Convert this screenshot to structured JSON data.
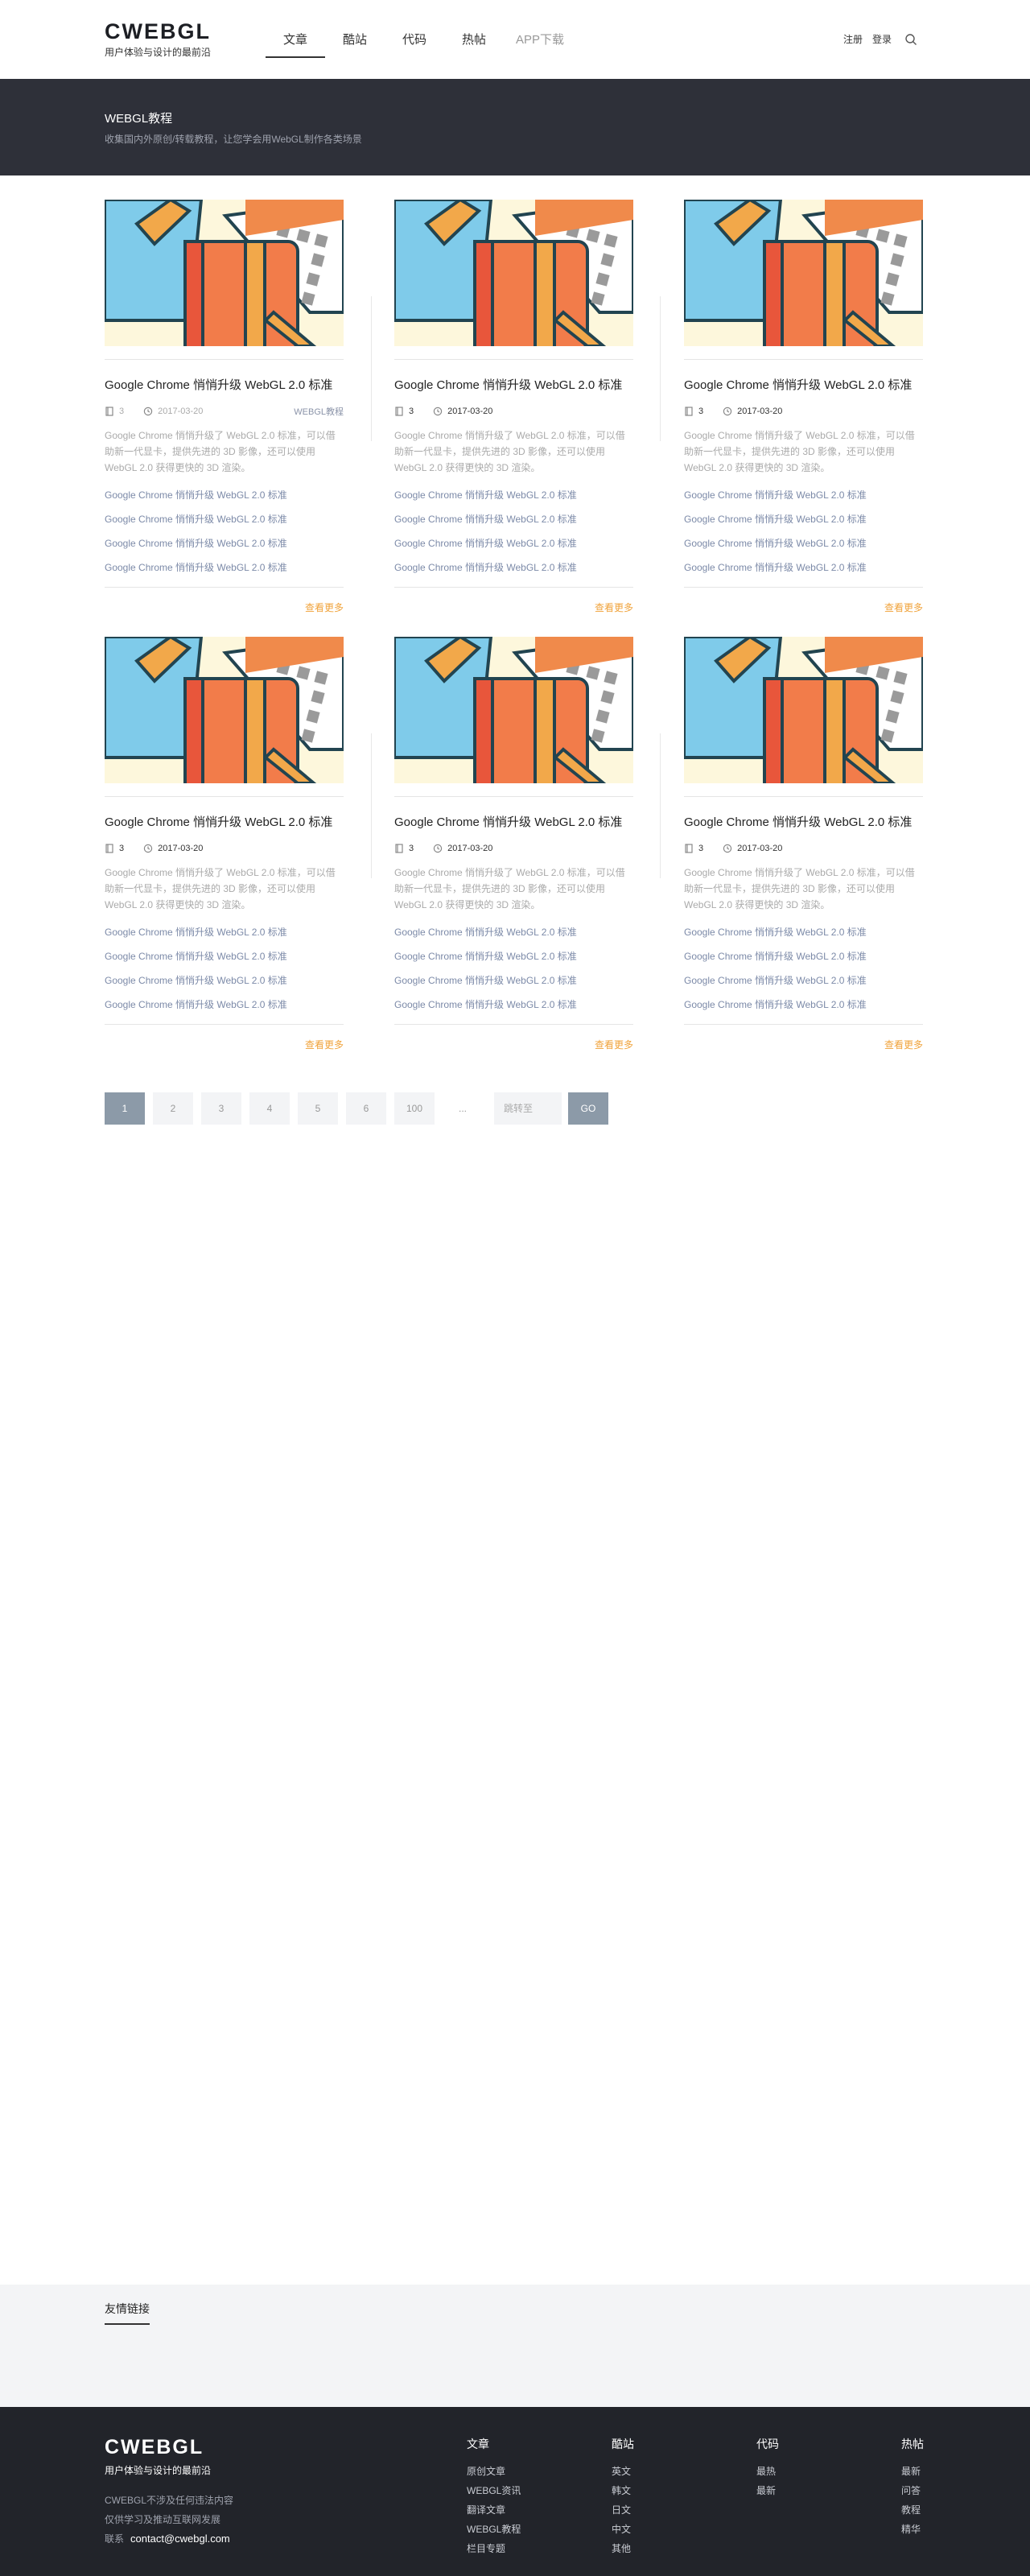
{
  "header": {
    "logo_title": "CWEBGL",
    "logo_sub": "用户体验与设计的最前沿",
    "nav": [
      "文章",
      "酷站",
      "代码",
      "热帖",
      "APP下载"
    ],
    "register": "注册",
    "login": "登录"
  },
  "banner": {
    "title": "WEBGL教程",
    "desc": "收集国内外原创/转载教程，让您学会用WebGL制作各类场景"
  },
  "cards": [
    {
      "title": "Google Chrome 悄悄升级 WebGL 2.0 标准",
      "count": "3",
      "date": "2017-03-20",
      "tag": "WEBGL教程",
      "desc": "Google Chrome 悄悄升级了 WebGL 2.0 标准，可以借助新一代显卡，提供先进的 3D 影像，还可以使用 WebGL 2.0 获得更快的 3D 渲染。",
      "links": [
        "Google Chrome 悄悄升级 WebGL 2.0 标准",
        "Google Chrome 悄悄升级 WebGL 2.0 标准",
        "Google Chrome 悄悄升级 WebGL 2.0 标准",
        "Google Chrome 悄悄升级 WebGL 2.0 标准"
      ],
      "more": "查看更多"
    },
    {
      "title": "Google Chrome 悄悄升级 WebGL 2.0 标准",
      "count": "3",
      "date": "2017-03-20",
      "tag": "",
      "desc": "Google Chrome 悄悄升级了 WebGL 2.0 标准，可以借助新一代显卡，提供先进的 3D 影像，还可以使用 WebGL 2.0 获得更快的 3D 渲染。",
      "links": [
        "Google Chrome 悄悄升级 WebGL 2.0 标准",
        "Google Chrome 悄悄升级 WebGL 2.0 标准",
        "Google Chrome 悄悄升级 WebGL 2.0 标准",
        "Google Chrome 悄悄升级 WebGL 2.0 标准"
      ],
      "more": "查看更多"
    },
    {
      "title": "Google Chrome 悄悄升级 WebGL 2.0 标准",
      "count": "3",
      "date": "2017-03-20",
      "tag": "",
      "desc": "Google Chrome 悄悄升级了 WebGL 2.0 标准，可以借助新一代显卡，提供先进的 3D 影像，还可以使用 WebGL 2.0 获得更快的 3D 渲染。",
      "links": [
        "Google Chrome 悄悄升级 WebGL 2.0 标准",
        "Google Chrome 悄悄升级 WebGL 2.0 标准",
        "Google Chrome 悄悄升级 WebGL 2.0 标准",
        "Google Chrome 悄悄升级 WebGL 2.0 标准"
      ],
      "more": "查看更多"
    },
    {
      "title": "Google Chrome 悄悄升级 WebGL 2.0 标准",
      "count": "3",
      "date": "2017-03-20",
      "tag": "",
      "desc": "Google Chrome 悄悄升级了 WebGL 2.0 标准，可以借助新一代显卡，提供先进的 3D 影像，还可以使用 WebGL 2.0 获得更快的 3D 渲染。",
      "links": [
        "Google Chrome 悄悄升级 WebGL 2.0 标准",
        "Google Chrome 悄悄升级 WebGL 2.0 标准",
        "Google Chrome 悄悄升级 WebGL 2.0 标准",
        "Google Chrome 悄悄升级 WebGL 2.0 标准"
      ],
      "more": "查看更多"
    },
    {
      "title": "Google Chrome 悄悄升级 WebGL 2.0 标准",
      "count": "3",
      "date": "2017-03-20",
      "tag": "",
      "desc": "Google Chrome 悄悄升级了 WebGL 2.0 标准，可以借助新一代显卡，提供先进的 3D 影像，还可以使用 WebGL 2.0 获得更快的 3D 渲染。",
      "links": [
        "Google Chrome 悄悄升级 WebGL 2.0 标准",
        "Google Chrome 悄悄升级 WebGL 2.0 标准",
        "Google Chrome 悄悄升级 WebGL 2.0 标准",
        "Google Chrome 悄悄升级 WebGL 2.0 标准"
      ],
      "more": "查看更多"
    },
    {
      "title": "Google Chrome 悄悄升级 WebGL 2.0 标准",
      "count": "3",
      "date": "2017-03-20",
      "tag": "",
      "desc": "Google Chrome 悄悄升级了 WebGL 2.0 标准，可以借助新一代显卡，提供先进的 3D 影像，还可以使用 WebGL 2.0 获得更快的 3D 渲染。",
      "links": [
        "Google Chrome 悄悄升级 WebGL 2.0 标准",
        "Google Chrome 悄悄升级 WebGL 2.0 标准",
        "Google Chrome 悄悄升级 WebGL 2.0 标准",
        "Google Chrome 悄悄升级 WebGL 2.0 标准"
      ],
      "more": "查看更多"
    }
  ],
  "pagination": {
    "pages": [
      "1",
      "2",
      "3",
      "4",
      "5",
      "6",
      "100"
    ],
    "ellipsis": "...",
    "jump_placeholder": "跳转至",
    "go": "GO"
  },
  "friends": {
    "title": "友情链接"
  },
  "footer": {
    "logo_title": "CWEBGL",
    "logo_sub": "用户体验与设计的最前沿",
    "line1": "CWEBGL不涉及任何违法内容",
    "line2": "仅供学习及推动互联网发展",
    "contact_label": "联系",
    "contact_email": "contact@cwebgl.com",
    "columns": [
      {
        "title": "文章",
        "items": [
          "原创文章",
          "WEBGL资讯",
          "翻译文章",
          "WEBGL教程",
          "栏目专题"
        ]
      },
      {
        "title": "酷站",
        "items": [
          "英文",
          "韩文",
          "日文",
          "中文",
          "其他"
        ]
      },
      {
        "title": "代码",
        "items": [
          "最热",
          "最新"
        ]
      },
      {
        "title": "热帖",
        "items": [
          "最新",
          "问答",
          "教程",
          "精华"
        ]
      }
    ]
  },
  "colors": {
    "banner_bg": "#2e3039",
    "footer_bg": "#22242a",
    "accent_more": "#f0a33b",
    "link_color": "#7c8aa8",
    "pager_active": "#8c9aa8"
  }
}
